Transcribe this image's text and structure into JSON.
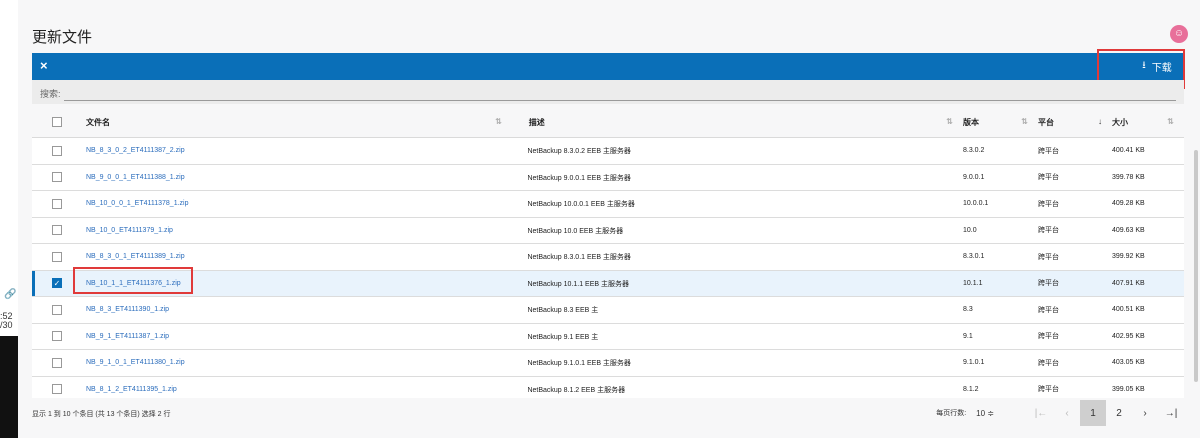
{
  "page": {
    "title": "更新文件"
  },
  "leftstrip": {
    "line1": ":52",
    "line2": "/30"
  },
  "toolbar": {
    "close_label": "×",
    "download_label": "下载",
    "download_icon": "download-icon"
  },
  "search": {
    "label": "搜索:",
    "value": ""
  },
  "table": {
    "headers": {
      "filename": "文件名",
      "description": "描述",
      "version": "版本",
      "platform": "平台",
      "size": "大小"
    },
    "rows": [
      {
        "filename": "NB_8_3_0_2_ET4111387_2.zip",
        "description": "NetBackup 8.3.0.2 EEB 主服务器",
        "version": "8.3.0.2",
        "platform": "跨平台",
        "size": "400.41 KB",
        "checked": false
      },
      {
        "filename": "NB_9_0_0_1_ET4111388_1.zip",
        "description": "NetBackup 9.0.0.1 EEB 主服务器",
        "version": "9.0.0.1",
        "platform": "跨平台",
        "size": "399.78 KB",
        "checked": false
      },
      {
        "filename": "NB_10_0_0_1_ET4111378_1.zip",
        "description": "NetBackup 10.0.0.1 EEB 主服务器",
        "version": "10.0.0.1",
        "platform": "跨平台",
        "size": "409.28 KB",
        "checked": false
      },
      {
        "filename": "NB_10_0_ET4111379_1.zip",
        "description": "NetBackup 10.0 EEB 主服务器",
        "version": "10.0",
        "platform": "跨平台",
        "size": "409.63 KB",
        "checked": false
      },
      {
        "filename": "NB_8_3_0_1_ET4111389_1.zip",
        "description": "NetBackup 8.3.0.1 EEB 主服务器",
        "version": "8.3.0.1",
        "platform": "跨平台",
        "size": "399.92 KB",
        "checked": false
      },
      {
        "filename": "NB_10_1_1_ET4111376_1.zip",
        "description": "NetBackup 10.1.1 EEB 主服务器",
        "version": "10.1.1",
        "platform": "跨平台",
        "size": "407.91 KB",
        "checked": true
      },
      {
        "filename": "NB_8_3_ET4111390_1.zip",
        "description": "NetBackup 8.3 EEB 主",
        "version": "8.3",
        "platform": "跨平台",
        "size": "400.51 KB",
        "checked": false
      },
      {
        "filename": "NB_9_1_ET4111387_1.zip",
        "description": "NetBackup 9.1 EEB 主",
        "version": "9.1",
        "platform": "跨平台",
        "size": "402.95 KB",
        "checked": false
      },
      {
        "filename": "NB_9_1_0_1_ET4111380_1.zip",
        "description": "NetBackup 9.1.0.1 EEB 主服务器",
        "version": "9.1.0.1",
        "platform": "跨平台",
        "size": "403.05 KB",
        "checked": false
      },
      {
        "filename": "NB_8_1_2_ET4111395_1.zip",
        "description": "NetBackup 8.1.2 EEB 主服务器",
        "version": "8.1.2",
        "platform": "跨平台",
        "size": "399.05 KB",
        "checked": false
      }
    ]
  },
  "footer": {
    "info": "显示 1 到 10 个条目 (共 13 个条目)   选择 2 行",
    "rows_per_page_label": "每页行数:",
    "rows_per_page_value": "10 ≑",
    "pages": [
      "1",
      "2"
    ],
    "current_page": "1"
  },
  "colors": {
    "accent": "#0a6fb8",
    "highlight": "#e03a3a",
    "link": "#2a6cbc"
  }
}
